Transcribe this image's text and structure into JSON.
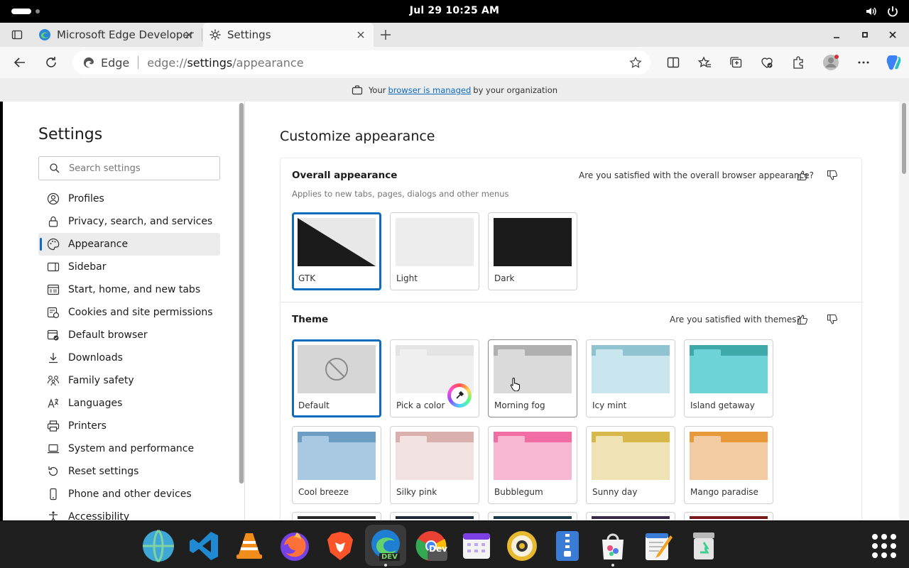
{
  "system_bar": {
    "clock": "Jul 29  10:25 AM",
    "icons": [
      "volume-icon",
      "power-icon"
    ]
  },
  "tabs": [
    {
      "label": "Microsoft Edge Developer",
      "icon": "edge-dev-icon",
      "active": false
    },
    {
      "label": "Settings",
      "icon": "gear-icon",
      "active": true
    }
  ],
  "omnibox": {
    "site_name": "Edge",
    "url_prefix": "edge://",
    "url_host": "settings",
    "url_path": "/appearance"
  },
  "banner": {
    "before": "Your",
    "link": "browser is managed",
    "after": "by your organization"
  },
  "sidebar": {
    "title": "Settings",
    "search_placeholder": "Search settings",
    "items": [
      {
        "label": "Profiles",
        "icon": "profile-icon"
      },
      {
        "label": "Privacy, search, and services",
        "icon": "lock-icon"
      },
      {
        "label": "Appearance",
        "icon": "palette-icon",
        "selected": true
      },
      {
        "label": "Sidebar",
        "icon": "sidebar-icon"
      },
      {
        "label": "Start, home, and new tabs",
        "icon": "home-tabs-icon"
      },
      {
        "label": "Cookies and site permissions",
        "icon": "cookie-icon"
      },
      {
        "label": "Default browser",
        "icon": "browser-icon"
      },
      {
        "label": "Downloads",
        "icon": "download-icon"
      },
      {
        "label": "Family safety",
        "icon": "family-icon"
      },
      {
        "label": "Languages",
        "icon": "language-icon"
      },
      {
        "label": "Printers",
        "icon": "printer-icon"
      },
      {
        "label": "System and performance",
        "icon": "laptop-icon"
      },
      {
        "label": "Reset settings",
        "icon": "reset-icon"
      },
      {
        "label": "Phone and other devices",
        "icon": "phone-icon"
      },
      {
        "label": "Accessibility",
        "icon": "accessibility-icon"
      }
    ]
  },
  "main": {
    "title": "Customize appearance",
    "overall": {
      "title": "Overall appearance",
      "subtitle": "Applies to new tabs, pages, dialogs and other menus",
      "feedback": "Are you satisfied with the overall browser appearance?",
      "options": [
        {
          "label": "GTK",
          "selected": true
        },
        {
          "label": "Light"
        },
        {
          "label": "Dark"
        }
      ]
    },
    "theme": {
      "title": "Theme",
      "feedback": "Are you satisfied with themes?",
      "options": [
        {
          "label": "Default",
          "selected": true,
          "bar": "#cfcfcf",
          "body": "#d6d6d6"
        },
        {
          "label": "Pick a color",
          "bar": "#e4e4e4",
          "body": "#efefef"
        },
        {
          "label": "Morning fog",
          "bar": "#b0b0b0",
          "body": "#dadada",
          "hover": true
        },
        {
          "label": "Icy mint",
          "bar": "#8fc3cf",
          "body": "#c9e6ee"
        },
        {
          "label": "Island getaway",
          "bar": "#3fa8a8",
          "body": "#6dd3d6"
        },
        {
          "label": "Cool breeze",
          "bar": "#6b9ec2",
          "body": "#a9c8e2"
        },
        {
          "label": "Silky pink",
          "bar": "#d9b0ae",
          "body": "#f2e1e1"
        },
        {
          "label": "Bubblegum",
          "bar": "#f06ea4",
          "body": "#f7b6d2"
        },
        {
          "label": "Sunny day",
          "bar": "#d8b84a",
          "body": "#efe3b5"
        },
        {
          "label": "Mango paradise",
          "bar": "#e89a3b",
          "body": "#f3cba2"
        }
      ]
    }
  },
  "taskbar": {
    "apps": [
      "globe-icon",
      "vscode-icon",
      "vlc-icon",
      "firefox-icon",
      "brave-icon",
      "edge-dev-icon",
      "chrome-dev-icon",
      "calendar-icon",
      "speaker-icon",
      "archive-icon",
      "store-icon",
      "text-editor-icon",
      "trash-icon"
    ],
    "edge_badge": "DEV",
    "chrome_badge": "Dev"
  }
}
